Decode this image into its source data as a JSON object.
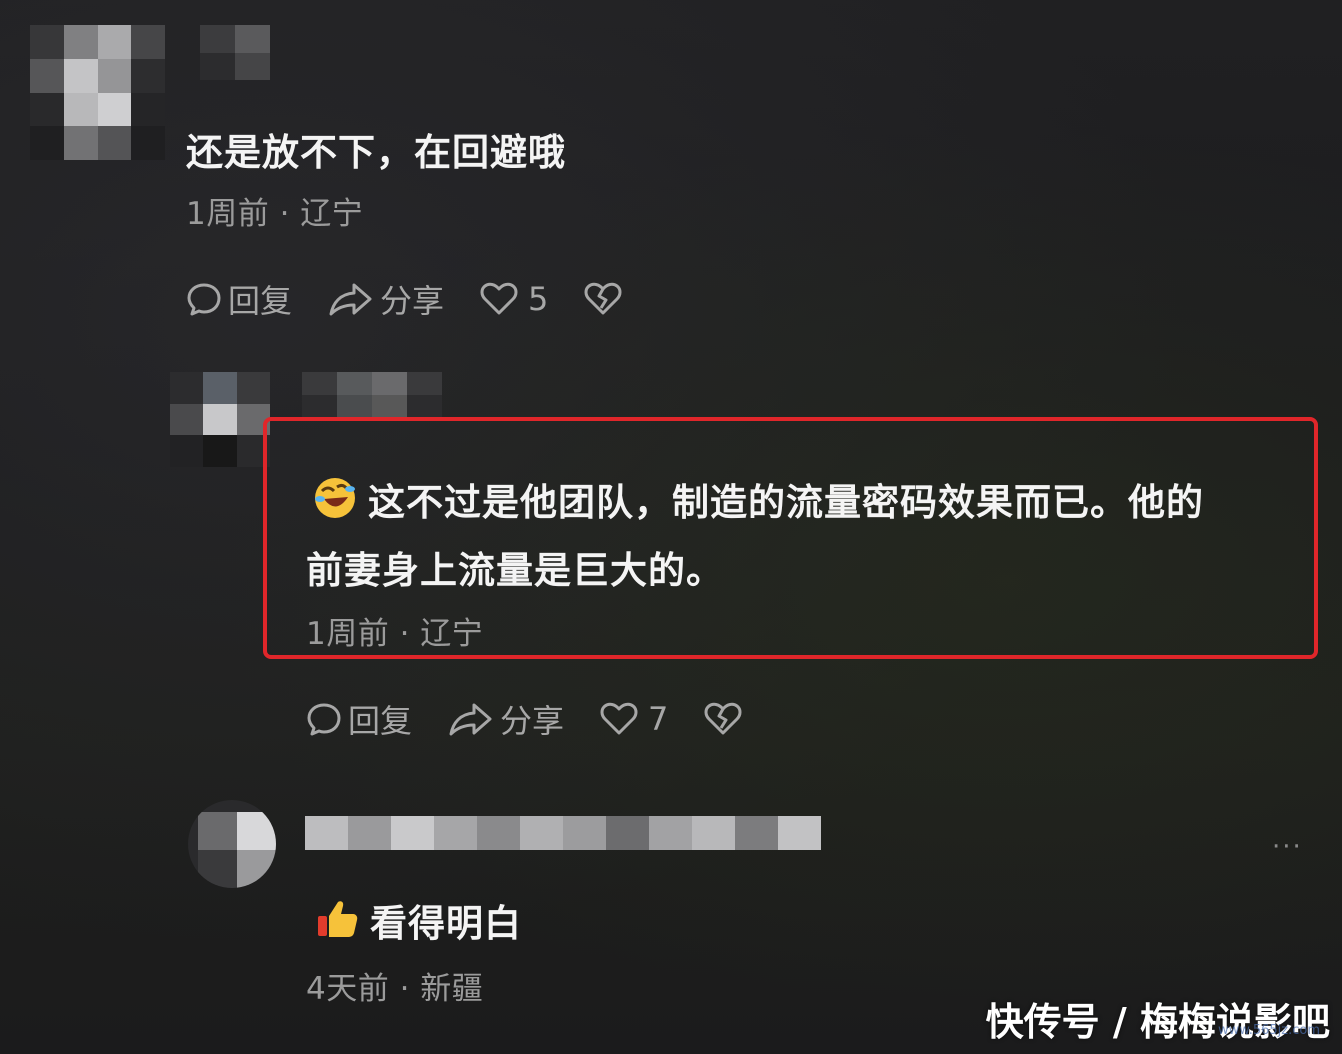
{
  "comments": [
    {
      "text": "还是放不下，在回避哦",
      "meta": "1周前 · 辽宁",
      "actions": {
        "reply": "回复",
        "share": "分享",
        "likes": "5"
      }
    },
    {
      "text_line1": "这不过是他团队，制造的流量密码效果而已。他的",
      "text_line2": "前妻身上流量是巨大的。",
      "emoji": "rolling-laughing-emoji",
      "meta": "1周前 · 辽宁",
      "actions": {
        "reply": "回复",
        "share": "分享",
        "likes": "7"
      }
    },
    {
      "text": "看得明白",
      "emoji": "thumbs-up-emoji",
      "meta": "4天前 · 新疆"
    }
  ],
  "more_menu": "···",
  "watermark": "快传号 / 梅梅说影吧",
  "watermark_url": "www.565jz.com",
  "colors": {
    "background": "#1d1d1f",
    "highlight_border": "#e0262a",
    "meta_text": "#9b9b9b",
    "body_text": "#f4f4f4"
  }
}
